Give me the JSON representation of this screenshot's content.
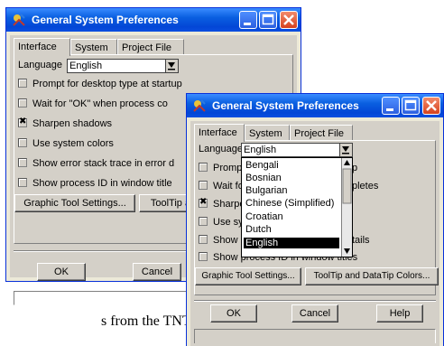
{
  "caption": "s from the TNTmips",
  "win1": {
    "title": "General System Preferences",
    "tabs": [
      "Interface",
      "System",
      "Project File"
    ],
    "language_label": "Language",
    "language_value": "English",
    "options": [
      {
        "label": "Prompt for desktop type at startup",
        "checked": false
      },
      {
        "label": "Wait for \"OK\" when process co",
        "checked": false
      },
      {
        "label": "Sharpen shadows",
        "checked": true
      },
      {
        "label": "Use system colors",
        "checked": false
      },
      {
        "label": "Show error stack trace in error d",
        "checked": false
      },
      {
        "label": "Show process ID in window title",
        "checked": false
      }
    ],
    "graphic_btn": "Graphic Tool Settings...",
    "tooltip_btn": "ToolTip a",
    "ok": "OK",
    "cancel": "Cancel"
  },
  "win2": {
    "title": "General System Preferences",
    "tabs": [
      "Interface",
      "System",
      "Project File"
    ],
    "language_label": "Language",
    "language_value": "English",
    "options": [
      {
        "label": "Prompt",
        "suffix": "p",
        "checked": false
      },
      {
        "label": "Wait for",
        "suffix": "pletes",
        "checked": false
      },
      {
        "label": "Sharpe",
        "suffix": "",
        "checked": true
      },
      {
        "label": "Use sy",
        "suffix": "",
        "checked": false
      },
      {
        "label": "Show e",
        "suffix": "tails",
        "checked": false
      },
      {
        "label": "Show process ID in window titles",
        "suffix": "",
        "checked": false
      }
    ],
    "dropdown": [
      "Bengali",
      "Bosnian",
      "Bulgarian",
      "Chinese (Simplified)",
      "Croatian",
      "Dutch",
      "English"
    ],
    "dropdown_selected": "English",
    "graphic_btn": "Graphic Tool Settings...",
    "tooltip_btn": "ToolTip and DataTip Colors...",
    "ok": "OK",
    "cancel": "Cancel",
    "help": "Help"
  },
  "colors": {
    "titlebar": "#0a5fe0",
    "face": "#d4d0c8",
    "close": "#d6421d"
  }
}
